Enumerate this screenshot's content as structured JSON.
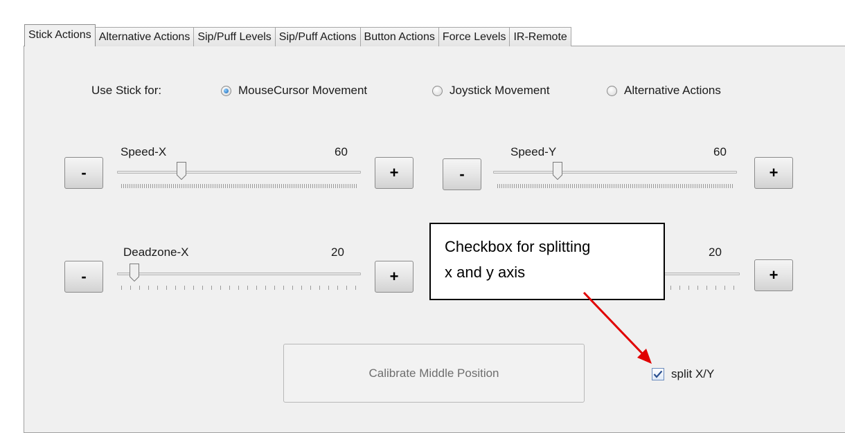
{
  "tabs": [
    {
      "label": "Stick Actions",
      "active": true
    },
    {
      "label": "Alternative Actions",
      "active": false
    },
    {
      "label": "Sip/Puff Levels",
      "active": false
    },
    {
      "label": "Sip/Puff Actions",
      "active": false
    },
    {
      "label": "Button Actions",
      "active": false
    },
    {
      "label": "Force Levels",
      "active": false
    },
    {
      "label": "IR-Remote",
      "active": false
    }
  ],
  "use_stick": {
    "label": "Use Stick for:",
    "options": [
      {
        "label": "MouseCursor Movement",
        "selected": true
      },
      {
        "label": "Joystick Movement",
        "selected": false
      },
      {
        "label": "Alternative Actions",
        "selected": false
      }
    ]
  },
  "sliders": {
    "speed_x": {
      "label": "Speed-X",
      "value": "60",
      "fraction": 0.25
    },
    "speed_y": {
      "label": "Speed-Y",
      "value": "60",
      "fraction": 0.25
    },
    "deadzone_x": {
      "label": "Deadzone-X",
      "value": "20",
      "fraction": 0.05
    },
    "deadzone_y": {
      "value": "20"
    }
  },
  "buttons": {
    "minus": "-",
    "plus": "+",
    "calibrate": "Calibrate Middle Position"
  },
  "split": {
    "label": "split X/Y",
    "checked": true
  },
  "callout": {
    "line1": "Checkbox for splitting",
    "line2": "x and y axis"
  },
  "colors": {
    "radio_selected": "#1560b0",
    "arrow": "#e00000",
    "checkmark": "#2a4f8f"
  },
  "icons": {
    "radio": "radio-button-icon",
    "check": "checkmark-icon",
    "arrow": "red-arrow-icon"
  }
}
